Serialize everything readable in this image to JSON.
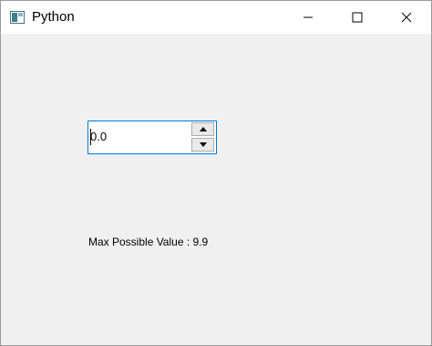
{
  "window": {
    "title": "Python",
    "icon": "python-window-icon",
    "controls": [
      "minimize-icon",
      "maximize-icon",
      "close-icon"
    ]
  },
  "spinbox": {
    "value": "0.0",
    "up_icon": "arrow-up-icon",
    "down_icon": "arrow-down-icon"
  },
  "label": {
    "text": "Max Possible Value : 9.9"
  },
  "colors": {
    "titlebar": "#ffffff",
    "client_background": "#f0f0f0",
    "focus_border": "#0078d7"
  }
}
